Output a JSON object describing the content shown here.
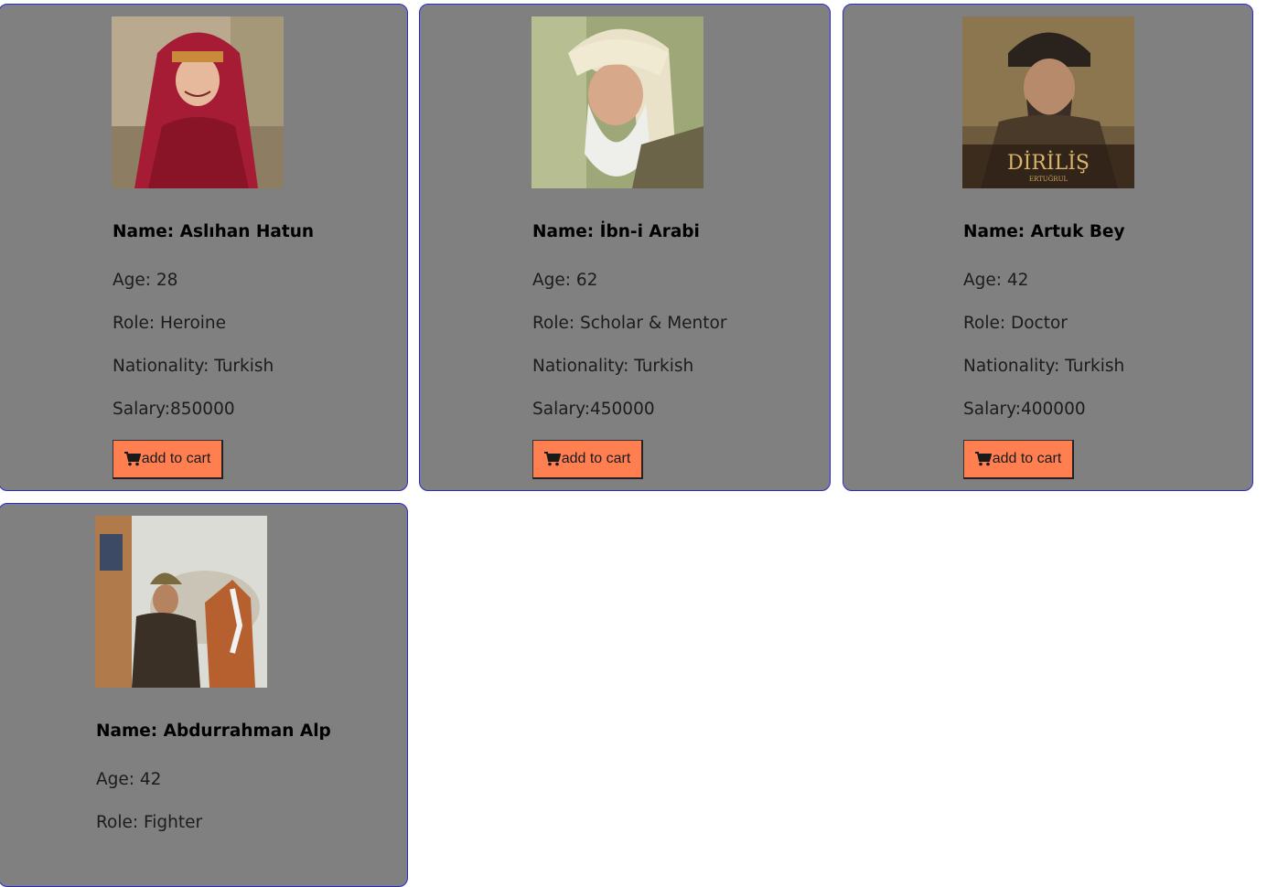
{
  "cards": [
    {
      "name_label": "Name: Aslıhan Hatun",
      "age_label": "Age: 28",
      "role_label": "Role: Heroine",
      "nationality_label": "Nationality: Turkish",
      "salary_label": "Salary:850000",
      "button_label": "add to cart",
      "photo_alt": "Aslıhan Hatun"
    },
    {
      "name_label": "Name: İbn-i Arabi",
      "age_label": "Age: 62",
      "role_label": "Role: Scholar & Mentor",
      "nationality_label": "Nationality: Turkish",
      "salary_label": "Salary:450000",
      "button_label": "add to cart",
      "photo_alt": "İbn-i Arabi"
    },
    {
      "name_label": "Name: Artuk Bey",
      "age_label": "Age: 42",
      "role_label": "Role: Doctor",
      "nationality_label": "Nationality: Turkish",
      "salary_label": "Salary:400000",
      "button_label": "add to cart",
      "photo_alt": "Artuk Bey",
      "photo_caption": "DİRİLİŞ",
      "photo_subcaption": "ERTUĞRUL"
    },
    {
      "name_label": "Name: Abdurrahman Alp",
      "age_label": "Age: 42",
      "role_label": "Role: Fighter",
      "photo_alt": "Abdurrahman Alp"
    }
  ],
  "colors": {
    "card_background": "#808080",
    "card_border": "#2a2ad0",
    "button_background": "#ff7f50"
  },
  "icons": {
    "cart": "shopping-cart-icon"
  }
}
